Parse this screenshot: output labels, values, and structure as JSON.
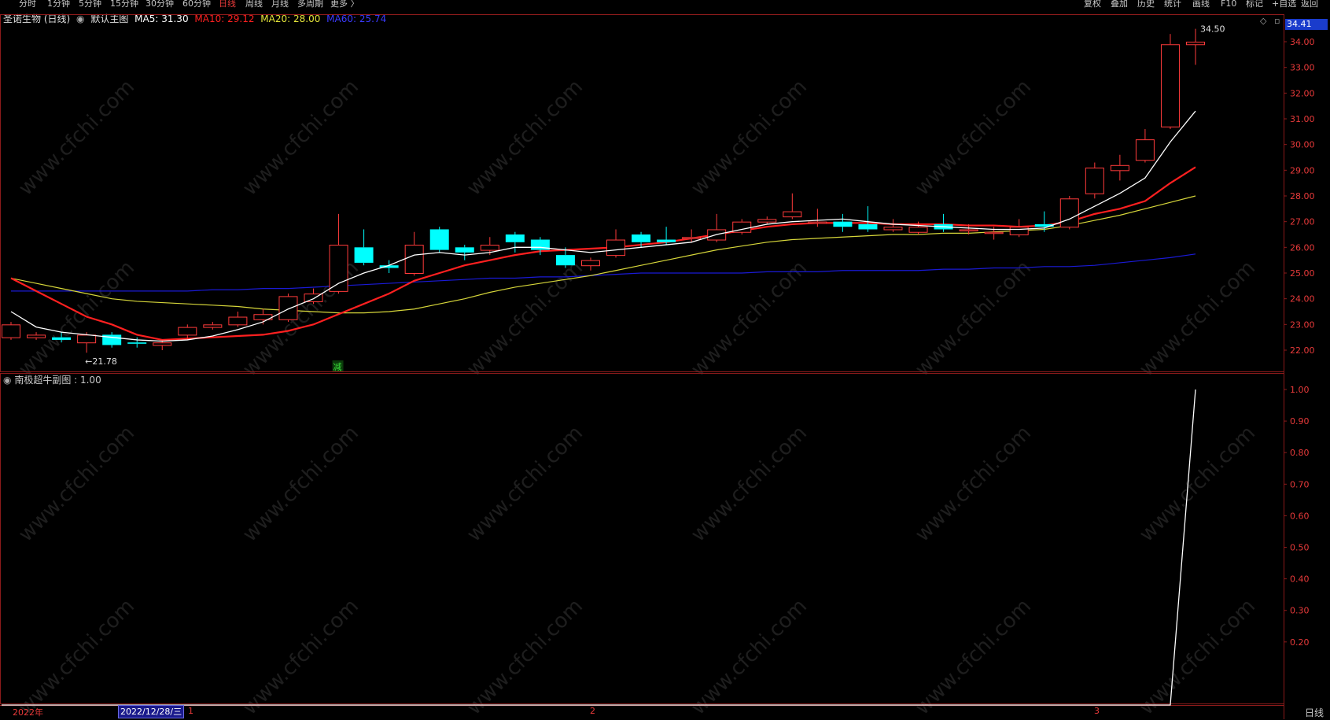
{
  "toolbar": {
    "periods": [
      "分时",
      "1分钟",
      "5分钟",
      "15分钟",
      "30分钟",
      "60分钟",
      "日线",
      "周线",
      "月线",
      "多周期",
      "更多 〉"
    ],
    "active_period": "日线",
    "right_buttons": [
      "复权",
      "叠加",
      "历史",
      "统计",
      "画线",
      "F10",
      "标记",
      "+自选",
      "返回"
    ]
  },
  "main_chart": {
    "stock_name": "圣诺生物 (日线)",
    "chart_label": "默认主图",
    "ma5": "MA5: 31.30",
    "ma10": "MA10: 29.12",
    "ma20": "MA20: 28.00",
    "ma60": "MA60: 25.74",
    "current_price_tag": "34.41",
    "high_label": "34.50",
    "low_label": "21.78",
    "reduce_marker": "减",
    "colors": {
      "up": "#ff3b3b",
      "down": "#00ffff",
      "ma5": "#ffffff",
      "ma10": "#ff2020",
      "ma20": "#d6d63a",
      "ma60": "#1a1ad6"
    }
  },
  "sub_chart": {
    "title": "南极超牛副图 : 1.00",
    "line_color": "#ffffff"
  },
  "x_axis": {
    "year_label": "2022年",
    "cursor_date": "2022/12/28/三",
    "month_labels": [
      "1",
      "2",
      "3"
    ],
    "period_label": "日线"
  },
  "chart_data": [
    {
      "type": "candlestick",
      "title": "圣诺生物 (日线)",
      "y_ticks": [
        "34.00",
        "33.00",
        "32.00",
        "31.00",
        "30.00",
        "29.00",
        "28.00",
        "27.00",
        "26.00",
        "25.00",
        "24.00",
        "23.00",
        "22.00"
      ],
      "ylim": [
        21.5,
        35.0
      ],
      "candles": [
        {
          "o": 22.5,
          "c": 23.0,
          "h": 23.1,
          "l": 22.4
        },
        {
          "o": 22.5,
          "c": 22.6,
          "h": 22.7,
          "l": 22.4
        },
        {
          "o": 22.5,
          "c": 22.4,
          "h": 22.7,
          "l": 22.3
        },
        {
          "o": 22.3,
          "c": 22.6,
          "h": 22.7,
          "l": 21.9
        },
        {
          "o": 22.6,
          "c": 22.2,
          "h": 22.7,
          "l": 22.1
        },
        {
          "o": 22.3,
          "c": 22.25,
          "h": 22.5,
          "l": 22.1
        },
        {
          "o": 22.2,
          "c": 22.3,
          "h": 22.4,
          "l": 22.0
        },
        {
          "o": 22.6,
          "c": 22.9,
          "h": 23.0,
          "l": 22.4
        },
        {
          "o": 22.9,
          "c": 23.0,
          "h": 23.1,
          "l": 22.8
        },
        {
          "o": 23.0,
          "c": 23.3,
          "h": 23.5,
          "l": 22.9
        },
        {
          "o": 23.2,
          "c": 23.4,
          "h": 23.6,
          "l": 23.0
        },
        {
          "o": 23.2,
          "c": 24.1,
          "h": 24.2,
          "l": 23.1
        },
        {
          "o": 23.9,
          "c": 24.2,
          "h": 24.4,
          "l": 23.8
        },
        {
          "o": 24.3,
          "c": 26.1,
          "h": 27.3,
          "l": 24.2
        },
        {
          "o": 26.0,
          "c": 25.4,
          "h": 26.7,
          "l": 25.3
        },
        {
          "o": 25.3,
          "c": 25.2,
          "h": 25.5,
          "l": 25.0
        },
        {
          "o": 25.0,
          "c": 26.1,
          "h": 26.6,
          "l": 24.9
        },
        {
          "o": 26.7,
          "c": 25.9,
          "h": 26.8,
          "l": 25.8
        },
        {
          "o": 26.0,
          "c": 25.8,
          "h": 26.1,
          "l": 25.5
        },
        {
          "o": 25.9,
          "c": 26.1,
          "h": 26.4,
          "l": 25.7
        },
        {
          "o": 26.5,
          "c": 26.2,
          "h": 26.6,
          "l": 25.8
        },
        {
          "o": 26.3,
          "c": 25.9,
          "h": 26.4,
          "l": 25.7
        },
        {
          "o": 25.7,
          "c": 25.3,
          "h": 26.0,
          "l": 25.2
        },
        {
          "o": 25.3,
          "c": 25.5,
          "h": 25.6,
          "l": 25.1
        },
        {
          "o": 25.7,
          "c": 26.3,
          "h": 26.7,
          "l": 25.6
        },
        {
          "o": 26.5,
          "c": 26.2,
          "h": 26.6,
          "l": 26.0
        },
        {
          "o": 26.3,
          "c": 26.2,
          "h": 26.8,
          "l": 26.1
        },
        {
          "o": 26.4,
          "c": 26.4,
          "h": 26.7,
          "l": 26.2
        },
        {
          "o": 26.3,
          "c": 26.7,
          "h": 27.3,
          "l": 26.2
        },
        {
          "o": 26.6,
          "c": 27.0,
          "h": 27.1,
          "l": 26.5
        },
        {
          "o": 27.0,
          "c": 27.1,
          "h": 27.2,
          "l": 26.9
        },
        {
          "o": 27.2,
          "c": 27.4,
          "h": 28.1,
          "l": 27.1
        },
        {
          "o": 27.0,
          "c": 27.0,
          "h": 27.5,
          "l": 26.8
        },
        {
          "o": 27.0,
          "c": 26.8,
          "h": 27.3,
          "l": 26.6
        },
        {
          "o": 26.9,
          "c": 26.7,
          "h": 27.6,
          "l": 26.6
        },
        {
          "o": 26.7,
          "c": 26.8,
          "h": 27.1,
          "l": 26.6
        },
        {
          "o": 26.6,
          "c": 26.8,
          "h": 27.0,
          "l": 26.5
        },
        {
          "o": 26.9,
          "c": 26.7,
          "h": 27.3,
          "l": 26.6
        },
        {
          "o": 26.7,
          "c": 26.7,
          "h": 26.9,
          "l": 26.5
        },
        {
          "o": 26.6,
          "c": 26.6,
          "h": 26.8,
          "l": 26.3
        },
        {
          "o": 26.5,
          "c": 26.8,
          "h": 27.1,
          "l": 26.4
        },
        {
          "o": 26.9,
          "c": 26.8,
          "h": 27.4,
          "l": 26.6
        },
        {
          "o": 26.8,
          "c": 27.9,
          "h": 28.0,
          "l": 26.7
        },
        {
          "o": 28.1,
          "c": 29.1,
          "h": 29.3,
          "l": 27.9
        },
        {
          "o": 29.0,
          "c": 29.2,
          "h": 29.6,
          "l": 28.6
        },
        {
          "o": 29.4,
          "c": 30.2,
          "h": 30.6,
          "l": 29.3
        },
        {
          "o": 30.7,
          "c": 33.9,
          "h": 34.3,
          "l": 30.6
        },
        {
          "o": 33.9,
          "c": 34.0,
          "h": 34.5,
          "l": 33.1
        }
      ],
      "ma5": [
        23.5,
        22.9,
        22.7,
        22.6,
        22.5,
        22.4,
        22.35,
        22.4,
        22.55,
        22.8,
        23.1,
        23.6,
        24.0,
        24.6,
        25.0,
        25.3,
        25.7,
        25.8,
        25.7,
        25.8,
        26.0,
        26.0,
        25.9,
        25.8,
        25.9,
        26.0,
        26.1,
        26.2,
        26.5,
        26.7,
        26.9,
        27.0,
        27.05,
        27.1,
        27.0,
        26.9,
        26.85,
        26.8,
        26.75,
        26.7,
        26.7,
        26.75,
        27.1,
        27.6,
        28.1,
        28.7,
        30.1,
        31.3
      ],
      "ma10": [
        24.8,
        24.3,
        23.8,
        23.3,
        23.0,
        22.6,
        22.4,
        22.45,
        22.5,
        22.55,
        22.6,
        22.75,
        23.0,
        23.4,
        23.8,
        24.2,
        24.7,
        25.0,
        25.3,
        25.5,
        25.7,
        25.85,
        25.9,
        25.95,
        26.0,
        26.1,
        26.2,
        26.35,
        26.5,
        26.65,
        26.8,
        26.9,
        26.95,
        26.95,
        26.95,
        26.9,
        26.9,
        26.9,
        26.85,
        26.85,
        26.8,
        26.85,
        27.0,
        27.3,
        27.5,
        27.8,
        28.5,
        29.12
      ],
      "ma20": [
        24.8,
        24.6,
        24.4,
        24.2,
        24.0,
        23.9,
        23.85,
        23.8,
        23.75,
        23.7,
        23.6,
        23.55,
        23.5,
        23.45,
        23.45,
        23.5,
        23.6,
        23.8,
        24.0,
        24.25,
        24.45,
        24.6,
        24.75,
        24.9,
        25.1,
        25.3,
        25.5,
        25.7,
        25.9,
        26.05,
        26.2,
        26.3,
        26.35,
        26.4,
        26.45,
        26.5,
        26.5,
        26.55,
        26.55,
        26.6,
        26.65,
        26.7,
        26.85,
        27.05,
        27.25,
        27.5,
        27.75,
        28.0
      ],
      "ma60": [
        24.3,
        24.3,
        24.3,
        24.3,
        24.3,
        24.3,
        24.3,
        24.3,
        24.35,
        24.35,
        24.4,
        24.4,
        24.45,
        24.5,
        24.55,
        24.6,
        24.65,
        24.7,
        24.75,
        24.8,
        24.8,
        24.85,
        24.85,
        24.9,
        24.95,
        25.0,
        25.0,
        25.0,
        25.0,
        25.0,
        25.05,
        25.05,
        25.05,
        25.1,
        25.1,
        25.1,
        25.1,
        25.15,
        25.15,
        25.2,
        25.2,
        25.25,
        25.25,
        25.3,
        25.4,
        25.5,
        25.6,
        25.74
      ]
    },
    {
      "type": "line",
      "title": "南极超牛副图",
      "y_ticks": [
        "1.00",
        "0.90",
        "0.80",
        "0.70",
        "0.60",
        "0.50",
        "0.40",
        "0.30",
        "0.20"
      ],
      "ylim": [
        0,
        1.0
      ],
      "values": [
        0,
        0,
        0,
        0,
        0,
        0,
        0,
        0,
        0,
        0,
        0,
        0,
        0,
        0,
        0,
        0,
        0,
        0,
        0,
        0,
        0,
        0,
        0,
        0,
        0,
        0,
        0,
        0,
        0,
        0,
        0,
        0,
        0,
        0,
        0,
        0,
        0,
        0,
        0,
        0,
        0,
        0,
        0,
        0,
        0,
        0,
        0,
        1.0
      ]
    }
  ]
}
